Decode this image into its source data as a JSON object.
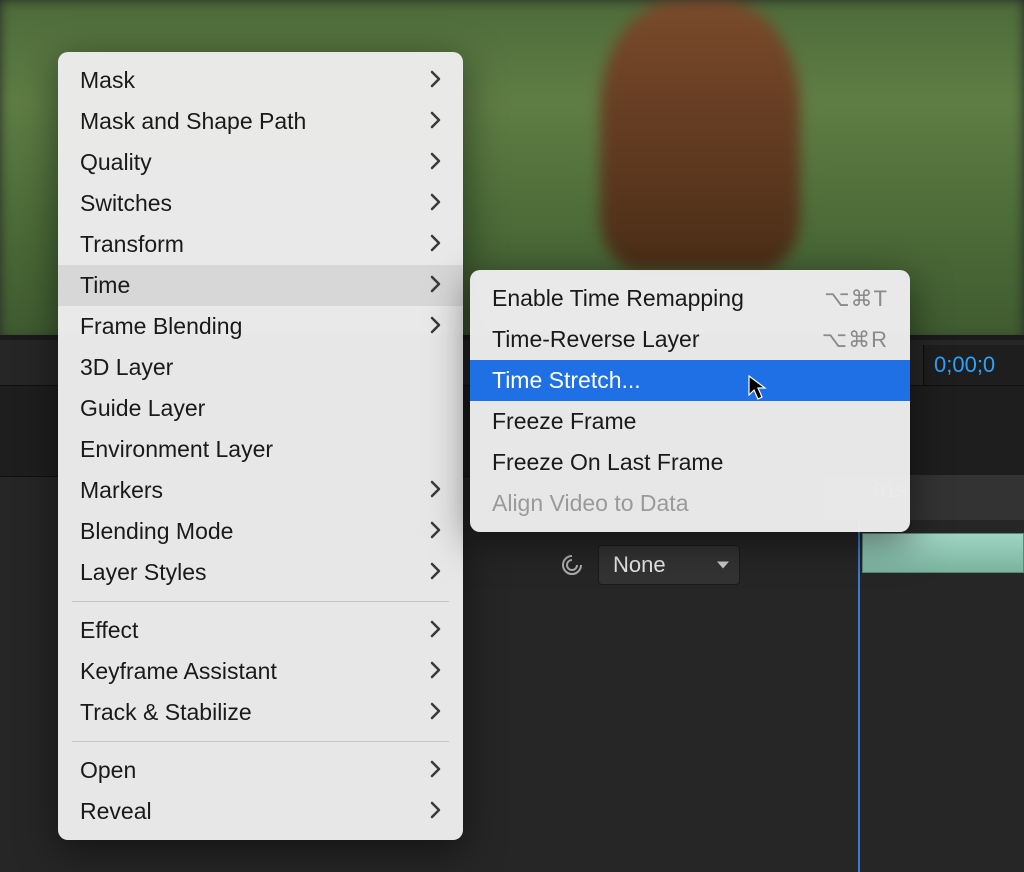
{
  "background": {
    "timecode": "0;00;0",
    "ruler_label": "01s",
    "parent_dropdown": "None"
  },
  "main_menu": {
    "items": [
      {
        "label": "Mask",
        "has_submenu": true
      },
      {
        "label": "Mask and Shape Path",
        "has_submenu": true
      },
      {
        "label": "Quality",
        "has_submenu": true
      },
      {
        "label": "Switches",
        "has_submenu": true
      },
      {
        "label": "Transform",
        "has_submenu": true
      },
      {
        "label": "Time",
        "has_submenu": true,
        "hovered": true
      },
      {
        "label": "Frame Blending",
        "has_submenu": true
      },
      {
        "label": "3D Layer"
      },
      {
        "label": "Guide Layer"
      },
      {
        "label": "Environment Layer"
      },
      {
        "label": "Markers",
        "has_submenu": true
      },
      {
        "label": "Blending Mode",
        "has_submenu": true
      },
      {
        "label": "Layer Styles",
        "has_submenu": true
      },
      {
        "separator": true
      },
      {
        "label": "Effect",
        "has_submenu": true
      },
      {
        "label": "Keyframe Assistant",
        "has_submenu": true
      },
      {
        "label": "Track & Stabilize",
        "has_submenu": true
      },
      {
        "separator": true
      },
      {
        "label": "Open",
        "has_submenu": true
      },
      {
        "label": "Reveal",
        "has_submenu": true
      }
    ]
  },
  "sub_menu": {
    "items": [
      {
        "label": "Enable Time Remapping",
        "shortcut": "⌥⌘T"
      },
      {
        "label": "Time-Reverse Layer",
        "shortcut": "⌥⌘R"
      },
      {
        "label": "Time Stretch...",
        "highlight": true
      },
      {
        "label": "Freeze Frame"
      },
      {
        "label": "Freeze On Last Frame"
      },
      {
        "label": "Align Video to Data",
        "disabled": true
      }
    ]
  }
}
